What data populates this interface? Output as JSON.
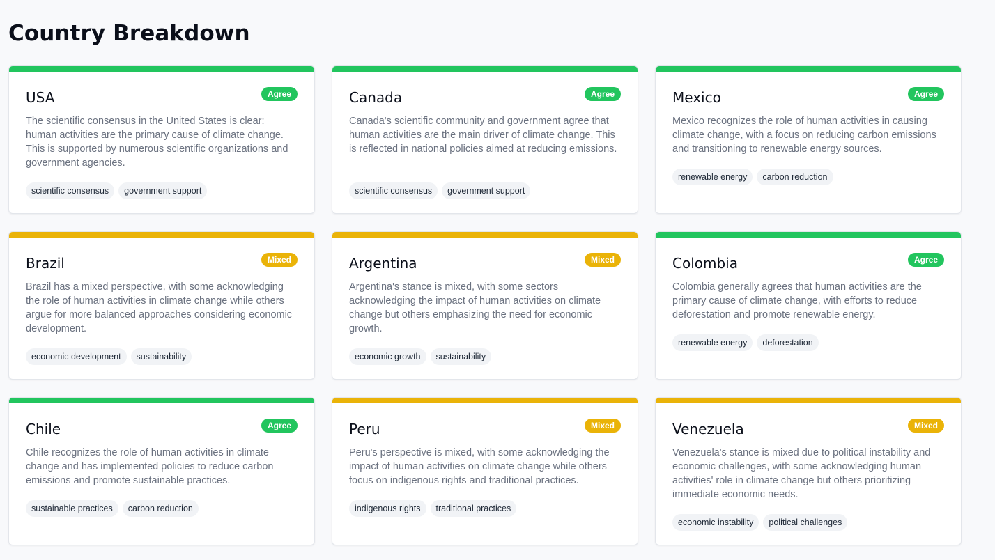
{
  "page": {
    "title": "Country Breakdown"
  },
  "colors": {
    "agree": "#22c55e",
    "mixed": "#eab308"
  },
  "countries": [
    {
      "name": "USA",
      "stance": "Agree",
      "description": "The scientific consensus in the United States is clear: human activities are the primary cause of climate change. This is supported by numerous scientific organizations and government agencies.",
      "tags": [
        "scientific consensus",
        "government support"
      ]
    },
    {
      "name": "Canada",
      "stance": "Agree",
      "description": "Canada's scientific community and government agree that human activities are the main driver of climate change. This is reflected in national policies aimed at reducing emissions.",
      "tags": [
        "scientific consensus",
        "government support"
      ]
    },
    {
      "name": "Mexico",
      "stance": "Agree",
      "description": "Mexico recognizes the role of human activities in causing climate change, with a focus on reducing carbon emissions and transitioning to renewable energy sources.",
      "tags": [
        "renewable energy",
        "carbon reduction"
      ]
    },
    {
      "name": "Brazil",
      "stance": "Mixed",
      "description": "Brazil has a mixed perspective, with some acknowledging the role of human activities in climate change while others argue for more balanced approaches considering economic development.",
      "tags": [
        "economic development",
        "sustainability"
      ]
    },
    {
      "name": "Argentina",
      "stance": "Mixed",
      "description": "Argentina's stance is mixed, with some sectors acknowledging the impact of human activities on climate change but others emphasizing the need for economic growth.",
      "tags": [
        "economic growth",
        "sustainability"
      ]
    },
    {
      "name": "Colombia",
      "stance": "Agree",
      "description": "Colombia generally agrees that human activities are the primary cause of climate change, with efforts to reduce deforestation and promote renewable energy.",
      "tags": [
        "renewable energy",
        "deforestation"
      ]
    },
    {
      "name": "Chile",
      "stance": "Agree",
      "description": "Chile recognizes the role of human activities in climate change and has implemented policies to reduce carbon emissions and promote sustainable practices.",
      "tags": [
        "sustainable practices",
        "carbon reduction"
      ]
    },
    {
      "name": "Peru",
      "stance": "Mixed",
      "description": "Peru's perspective is mixed, with some acknowledging the impact of human activities on climate change while others focus on indigenous rights and traditional practices.",
      "tags": [
        "indigenous rights",
        "traditional practices"
      ]
    },
    {
      "name": "Venezuela",
      "stance": "Mixed",
      "description": "Venezuela's stance is mixed due to political instability and economic challenges, with some acknowledging human activities' role in climate change but others prioritizing immediate economic needs.",
      "tags": [
        "economic instability",
        "political challenges"
      ]
    }
  ]
}
